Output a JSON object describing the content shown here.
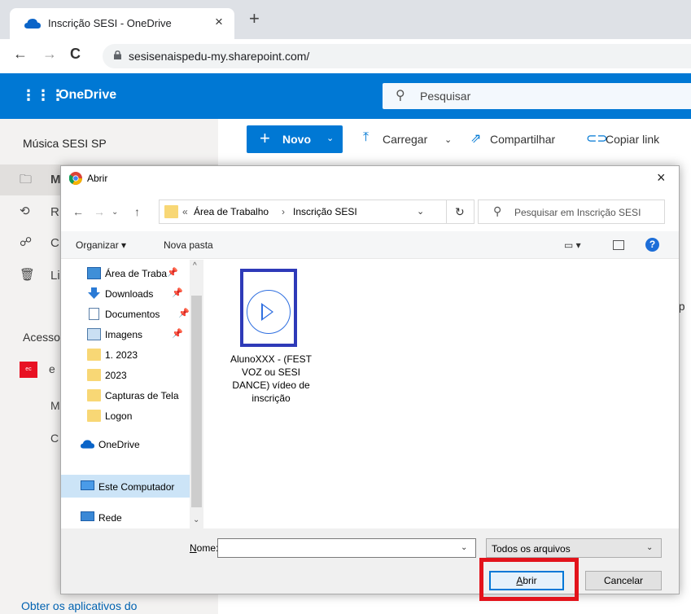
{
  "browser": {
    "tab_title": "Inscrição SESI - OneDrive",
    "tab_close": "×",
    "new_tab": "+",
    "url": "sesisenaispedu-my.sharepoint.com/"
  },
  "onedrive": {
    "brand": "OneDrive",
    "search_placeholder": "Pesquisar",
    "site_name": "Música SESI SP",
    "nav": [
      "M",
      "R",
      "C",
      "Li"
    ],
    "section_heading": "Acesso",
    "quick_items": [
      "e",
      "M",
      "C"
    ],
    "partial_right": "np",
    "footer_link": "Obter os aplicativos do",
    "toolbar": {
      "novo": "Novo",
      "carregar": "Carregar",
      "compartilhar": "Compartilhar",
      "copiar_link": "Copiar link"
    }
  },
  "dialog": {
    "title": "Abrir",
    "close": "×",
    "path": [
      "Área de Trabalho",
      "Inscrição SESI"
    ],
    "search_placeholder": "Pesquisar em Inscrição SESI",
    "organize": "Organizar ▾",
    "new_folder": "Nova pasta",
    "help": "?",
    "tree": [
      {
        "label": "Área de Traba",
        "icon": "desktop-icon",
        "pinned": true
      },
      {
        "label": "Downloads",
        "icon": "download-icon",
        "pinned": true
      },
      {
        "label": "Documentos",
        "icon": "document-icon",
        "pinned": true
      },
      {
        "label": "Imagens",
        "icon": "image-icon",
        "pinned": true
      },
      {
        "label": "1. 2023",
        "icon": "folder-icon",
        "pinned": false
      },
      {
        "label": "2023",
        "icon": "folder-icon",
        "pinned": false
      },
      {
        "label": "Capturas de Tela",
        "icon": "folder-icon",
        "pinned": false
      },
      {
        "label": "Logon",
        "icon": "folder-icon",
        "pinned": false
      },
      {
        "label": "OneDrive",
        "icon": "cloud-icon",
        "pinned": false
      },
      {
        "label": "Este Computador",
        "icon": "computer-icon",
        "pinned": false,
        "selected": true
      },
      {
        "label": "Rede",
        "icon": "network-icon",
        "pinned": false
      }
    ],
    "file": {
      "name_lines": [
        "AlunoXXX - (FEST",
        "VOZ ou SESI",
        "DANCE) vídeo de",
        "inscrição"
      ],
      "icon": "video-file-icon"
    },
    "name_label_prefix": "N",
    "name_label_rest": "ome:",
    "name_value": "",
    "file_type": "Todos os arquivos",
    "open_prefix": "A",
    "open_rest": "brir",
    "cancel": "Cancelar"
  },
  "colors": {
    "onedrive_blue": "#0078d4",
    "highlight_red": "#e3131b",
    "file_highlight_blue": "#2e3ab8"
  }
}
